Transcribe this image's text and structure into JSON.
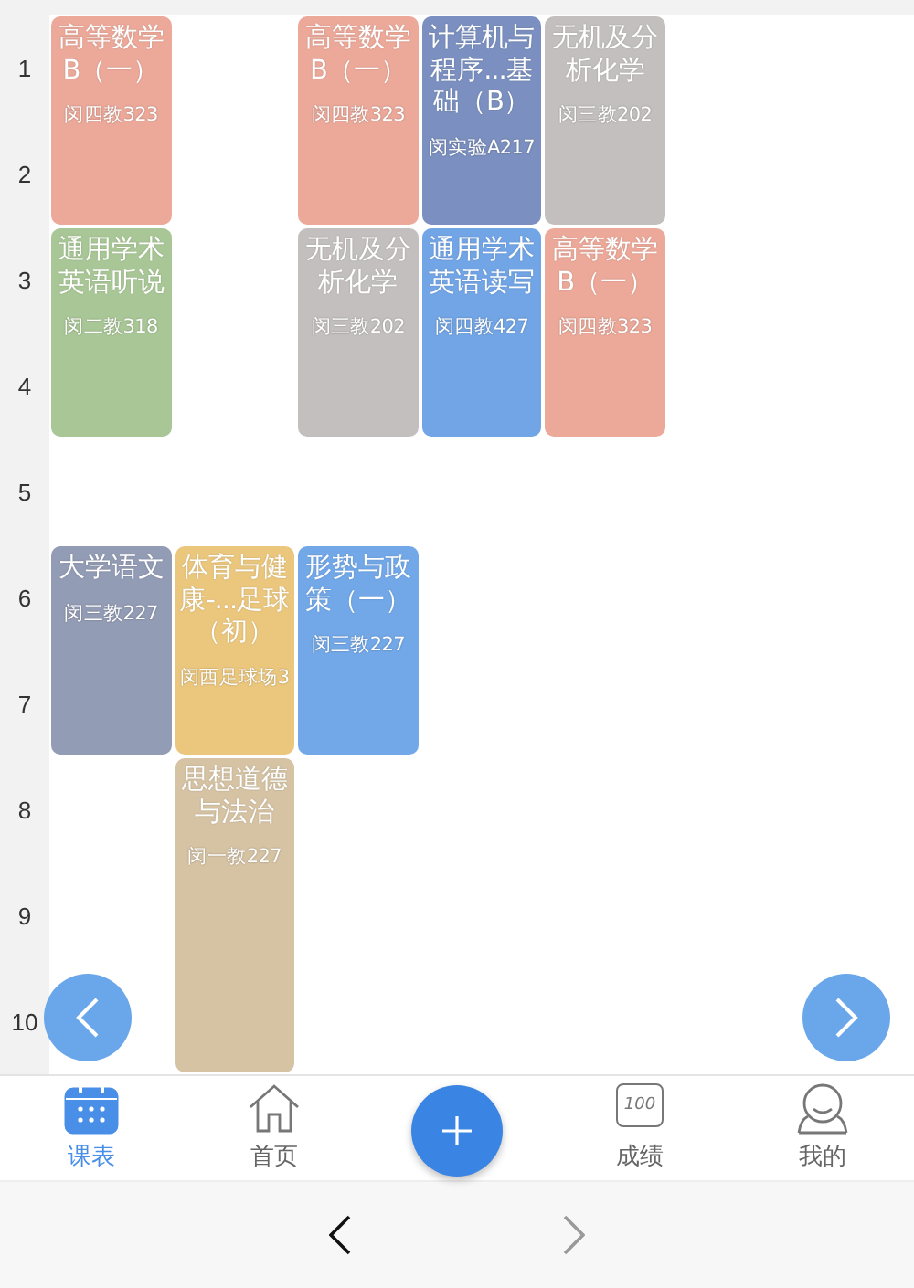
{
  "periods": [
    "1",
    "2",
    "3",
    "4",
    "5",
    "6",
    "7",
    "8",
    "9",
    "10"
  ],
  "days": [
    {
      "blocks": [
        {
          "kind": "double",
          "title": "高等数学B（一）",
          "room": "闵四教323",
          "color": "#eca99a"
        },
        {
          "kind": "double",
          "title": "通用学术英语听说",
          "room": "闵二教318",
          "color": "#a9c796"
        },
        {
          "kind": "gap"
        },
        {
          "kind": "double",
          "title": "大学语文",
          "room": "闵三教227",
          "color": "#939cb5"
        }
      ]
    },
    {
      "blocks": [
        {
          "kind": "gap"
        },
        {
          "kind": "gap"
        },
        {
          "kind": "gap"
        },
        {
          "kind": "gap"
        },
        {
          "kind": "gap"
        },
        {
          "kind": "double",
          "title": "体育与健康-...足球（初）",
          "room": "闵西足球场3",
          "color": "#ebc77e"
        },
        {
          "kind": "triple",
          "title": "思想道德与法治",
          "room": "闵一教227",
          "color": "#d6c3a4"
        }
      ]
    },
    {
      "blocks": [
        {
          "kind": "double",
          "title": "高等数学B（一）",
          "room": "闵四教323",
          "color": "#eca99a"
        },
        {
          "kind": "double",
          "title": "无机及分析化学",
          "room": "闵三教202",
          "color": "#c4bfbf"
        },
        {
          "kind": "gap"
        },
        {
          "kind": "double",
          "title": "形势与政策（一）",
          "room": "闵三教227",
          "color": "#72a8e8"
        }
      ]
    },
    {
      "blocks": [
        {
          "kind": "double",
          "title": "计算机与程序...基础（B）",
          "room": "闵实验A217",
          "color": "#7b90c0"
        },
        {
          "kind": "double",
          "title": "通用学术英语读写",
          "room": "闵四教427",
          "color": "#72a5e6"
        }
      ]
    },
    {
      "blocks": [
        {
          "kind": "double",
          "title": "无机及分析化学",
          "room": "闵三教202",
          "color": "#c4bfbf"
        },
        {
          "kind": "double",
          "title": "高等数学B（一）",
          "room": "闵四教323",
          "color": "#eca99a"
        }
      ]
    }
  ],
  "nav": [
    {
      "kind": "calendar",
      "label": "课表",
      "selected": true
    },
    {
      "kind": "home",
      "label": "首页",
      "selected": false
    },
    {
      "kind": "add"
    },
    {
      "kind": "score",
      "label": "成绩",
      "badge": "100",
      "selected": false
    },
    {
      "kind": "profile",
      "label": "我的",
      "selected": false
    }
  ],
  "browser": {
    "back": {
      "disabled": false
    },
    "forward": {
      "disabled": true
    }
  }
}
